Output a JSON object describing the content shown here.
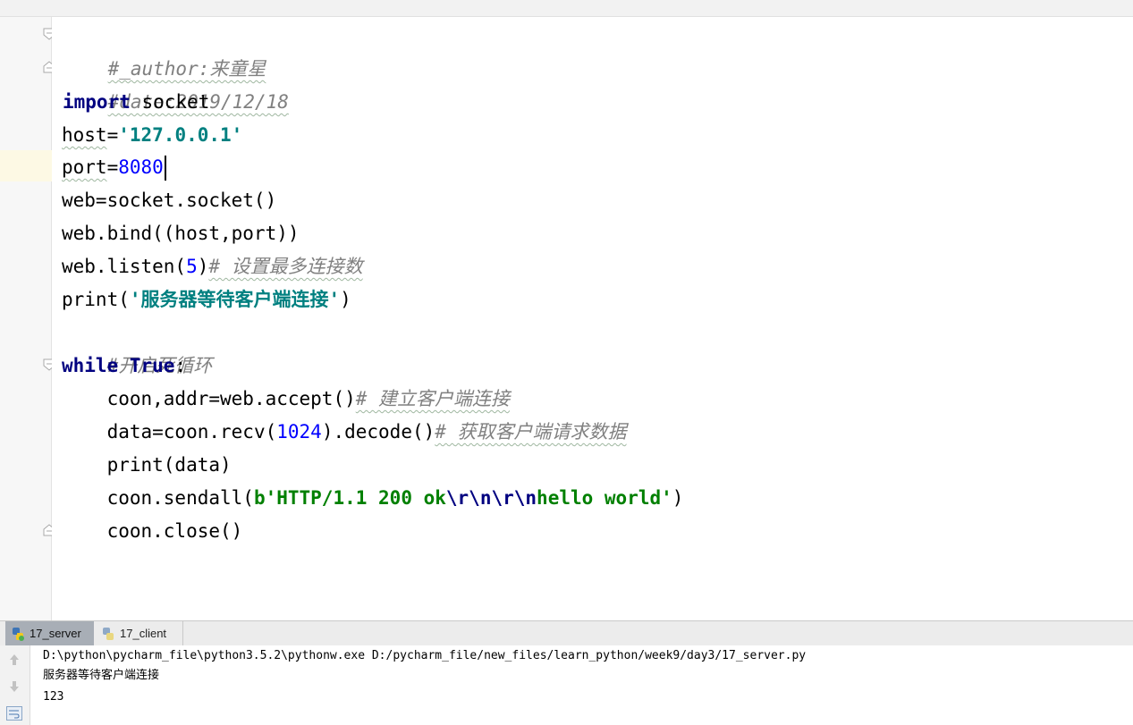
{
  "editor": {
    "lines": [
      {
        "comment": "#_author:来童星"
      },
      {
        "comment": "#date:2019/12/18"
      },
      {
        "kw": "import",
        "rest": " socket"
      },
      {
        "name": "host",
        "op": "=",
        "str": "'127.0.0.1'"
      },
      {
        "name": "port",
        "op": "=",
        "num": "8080"
      },
      {
        "code": "web=socket.socket()"
      },
      {
        "code": "web.bind((host,port))"
      },
      {
        "code": "web.listen(",
        "num": "5",
        "code2": ")",
        "comment": "# 设置最多连接数"
      },
      {
        "code": "print(",
        "str": "'服务器等待客户端连接'",
        "code2": ")"
      },
      {
        "comment": "#开启死循环"
      },
      {
        "kw": "while",
        "kw2": "True",
        "rest": ":"
      },
      {
        "indent": "    ",
        "code": "coon,addr=web.accept()",
        "comment": "# 建立客户端连接"
      },
      {
        "indent": "    ",
        "code": "data=coon.recv(",
        "num": "1024",
        "code2": ").decode()",
        "comment": "# 获取客户端请求数据"
      },
      {
        "indent": "    ",
        "code": "print(data)"
      },
      {
        "indent": "    ",
        "code": "coon.sendall(",
        "bstr1": "b'HTTP/1.1 200 ok",
        "esc": "\\r\\n\\r\\n",
        "bstr2": "hello world'",
        "code2": ")"
      },
      {
        "indent": "    ",
        "code": "coon.close()"
      }
    ]
  },
  "run_tabs": [
    {
      "label": "17_server",
      "active": true
    },
    {
      "label": "17_client",
      "active": false
    }
  ],
  "console": {
    "lines": [
      "D:\\python\\pycharm_file\\python3.5.2\\pythonw.exe D:/pycharm_file/new_files/learn_python/week9/day3/17_server.py",
      "服务器等待客户端连接",
      "123"
    ]
  },
  "colors": {
    "keyword": "#000080",
    "string": "#008080",
    "bytes_string": "#008000",
    "number": "#0000ff",
    "comment": "#808080",
    "current_line": "#fdf9e4"
  },
  "icons": [
    "fold-start-icon",
    "fold-end-icon",
    "python-icon",
    "arrow-up-icon",
    "arrow-down-icon",
    "soft-wrap-icon"
  ]
}
